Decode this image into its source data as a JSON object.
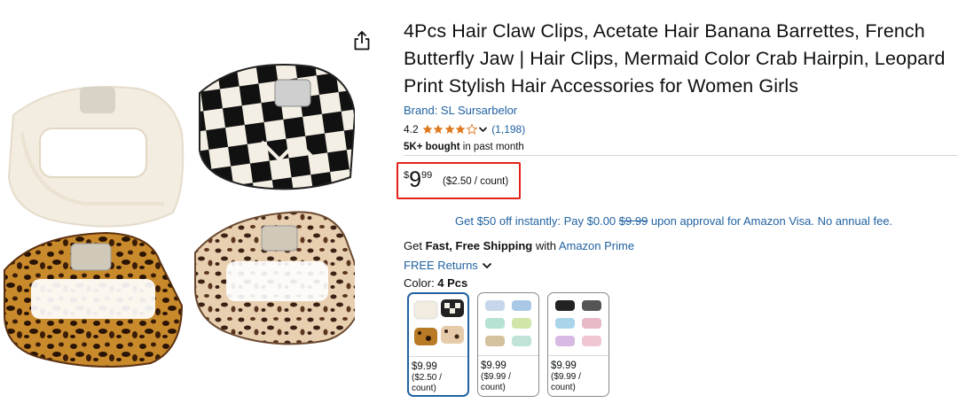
{
  "product": {
    "title": "4Pcs Hair Claw Clips, Acetate Hair Banana Barrettes, French Butterfly Jaw | Hair Clips, Mermaid Color Crab Hairpin, Leopard Print Stylish Hair Accessories for Women Girls",
    "brand": "Brand: SL Sursarbelor",
    "rating": "4.2",
    "rating_count": "(1,198)",
    "bought_bold": "5K+ bought",
    "bought_rest": " in past month"
  },
  "price": {
    "symbol": "$",
    "whole": "9",
    "fraction": "99",
    "unit": "($2.50 / count)"
  },
  "offer": {
    "text_before": "Get $50 off instantly: Pay $0.00 ",
    "strike": "$9.99",
    "text_after": " upon approval for Amazon Visa. No annual fee."
  },
  "shipping": {
    "prefix": "Get ",
    "bold": "Fast, Free Shipping",
    "middle": " with ",
    "prime": "Amazon Prime"
  },
  "returns": {
    "label": "FREE Returns"
  },
  "color": {
    "label": "Color: ",
    "value": "4 Pcs"
  },
  "swatches": [
    {
      "price": "$9.99",
      "unit": "($2.50 / count)"
    },
    {
      "price": "$9.99",
      "unit": "($9.99 / count)"
    },
    {
      "price": "$9.99",
      "unit": "($9.99 / count)"
    }
  ],
  "icons": {
    "share": "share-icon",
    "star": "star-icon",
    "chevron": "chevron-down-icon"
  },
  "colors": {
    "link": "#2162a1",
    "star": "#de7921",
    "price_highlight_border": "#e3221a",
    "text": "#0f1111"
  }
}
